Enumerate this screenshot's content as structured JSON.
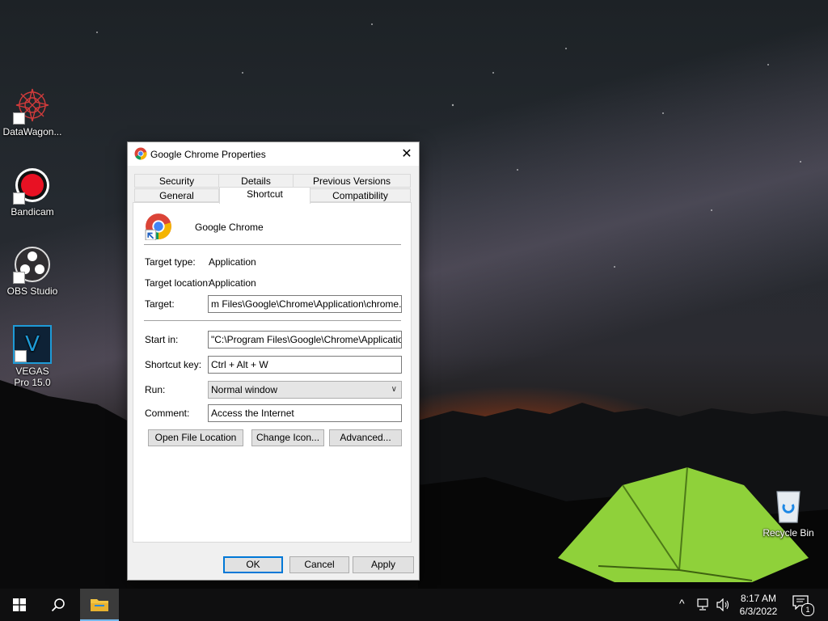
{
  "desktop": {
    "icons": [
      {
        "label": "DataWagon...",
        "icon": "datawagon-icon"
      },
      {
        "label": "Bandicam",
        "icon": "bandicam-icon"
      },
      {
        "label": "OBS Studio",
        "icon": "obs-icon"
      },
      {
        "label": "VEGAS Pro 15.0",
        "icon": "vegas-icon",
        "glyph": "V"
      },
      {
        "label": "Recycle Bin",
        "icon": "recycle-bin-icon"
      }
    ]
  },
  "dialog": {
    "title": "Google Chrome Properties",
    "close_glyph": "✕",
    "tabs_row1": [
      "Security",
      "Details",
      "Previous Versions"
    ],
    "tabs_row2": [
      "General",
      "Shortcut",
      "Compatibility"
    ],
    "active_tab": "Shortcut",
    "app_name": "Google Chrome",
    "fields": {
      "target_type_label": "Target type:",
      "target_type_value": "Application",
      "target_location_label": "Target location:",
      "target_location_value": "Application",
      "target_label": "Target:",
      "target_value": "m Files\\Google\\Chrome\\Application\\chrome.exe\"",
      "start_in_label": "Start in:",
      "start_in_value": "\"C:\\Program Files\\Google\\Chrome\\Application\"",
      "shortcut_key_label": "Shortcut key:",
      "shortcut_key_value": "Ctrl + Alt + W",
      "run_label": "Run:",
      "run_value": "Normal window",
      "comment_label": "Comment:",
      "comment_value": "Access the Internet"
    },
    "buttons": {
      "open_file_location": "Open File Location",
      "change_icon": "Change Icon...",
      "advanced": "Advanced...",
      "ok": "OK",
      "cancel": "Cancel",
      "apply": "Apply"
    }
  },
  "taskbar": {
    "start_icon": "windows-start-icon",
    "search_icon": "search-icon",
    "pinned": [
      {
        "name": "File Explorer",
        "icon": "folder-icon",
        "active": true
      }
    ],
    "tray": {
      "chevron": "^",
      "time": "8:17 AM",
      "date": "6/3/2022",
      "notification_count": "1"
    }
  },
  "colors": {
    "accent": "#0078d7",
    "bandicam_red": "#e81123",
    "vegas_blue": "#1e9bd7",
    "tent_green": "#8fd13a"
  }
}
